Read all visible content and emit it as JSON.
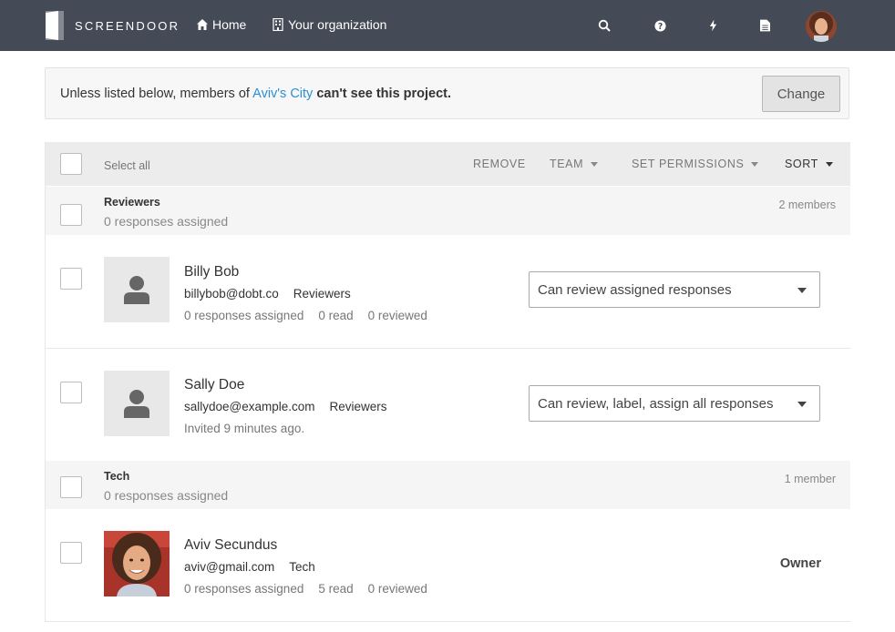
{
  "topbar": {
    "brand": "SCREENDOOR",
    "nav": [
      {
        "label": "Home",
        "icon": "home-icon"
      },
      {
        "label": "Your organization",
        "icon": "building-icon"
      }
    ],
    "icons": [
      "search-icon",
      "help-icon",
      "lightning-icon",
      "document-icon"
    ],
    "user_avatar": "user-avatar"
  },
  "notice": {
    "prefix": "Unless listed below, members of ",
    "org_link": "Aviv's City",
    "emphasis": "can't see this project.",
    "button": "Change"
  },
  "toolbar": {
    "select_all": "Select all",
    "remove": "REMOVE",
    "team": "TEAM",
    "set_permissions": "SET PERMISSIONS",
    "sort": "SORT"
  },
  "groups": [
    {
      "name": "Reviewers",
      "assigned": "0 responses assigned",
      "count": "2 members",
      "members": [
        {
          "name": "Billy Bob",
          "email": "billybob@dobt.co",
          "team": "Reviewers",
          "assigned": "0 responses assigned",
          "read": "0 read",
          "reviewed": "0 reviewed",
          "permission": "Can review assigned responses"
        },
        {
          "name": "Sally Doe",
          "email": "sallydoe@example.com",
          "team": "Reviewers",
          "invited": "Invited 9 minutes ago.",
          "permission": "Can review, label, assign all responses"
        }
      ]
    },
    {
      "name": "Tech",
      "assigned": "0 responses assigned",
      "count": "1 member",
      "members": [
        {
          "name": "Aviv Secundus",
          "email": "aviv@gmail.com",
          "team": "Tech",
          "assigned": "0 responses assigned",
          "read": "5 read",
          "reviewed": "0 reviewed",
          "role": "Owner"
        }
      ]
    }
  ],
  "colors": {
    "topbar": "#444b56",
    "link": "#2b8fd6",
    "group_bg": "#f5f5f5",
    "toolbar_bg": "#ececec"
  }
}
